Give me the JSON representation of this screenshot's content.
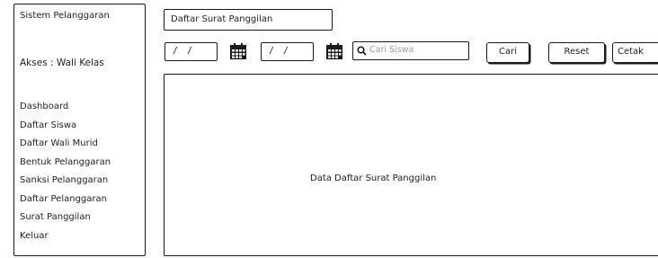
{
  "sidebar": {
    "app_title": "Sistem Pelanggaran",
    "access": "Akses : Wali Kelas",
    "items": [
      {
        "label": "Dashboard"
      },
      {
        "label": "Daftar Siswa"
      },
      {
        "label": "Daftar Wali Murid"
      },
      {
        "label": "Bentuk Pelanggaran"
      },
      {
        "label": "Sanksi Pelanggaran"
      },
      {
        "label": "Daftar Pelanggaran"
      },
      {
        "label": "Surat Panggilan"
      },
      {
        "label": "Keluar"
      }
    ]
  },
  "header": {
    "page_title": "Daftar Surat Panggilan"
  },
  "filters": {
    "date_from": "/ /",
    "date_to": "/ /",
    "calendar_icon": "calendar-icon",
    "search_icon": "search-icon",
    "search_placeholder": "Cari Siswa"
  },
  "buttons": {
    "cari": "Cari",
    "reset": "Reset",
    "cetak": "Cetak"
  },
  "content": {
    "placeholder": "Data Daftar Surat Panggilan"
  }
}
